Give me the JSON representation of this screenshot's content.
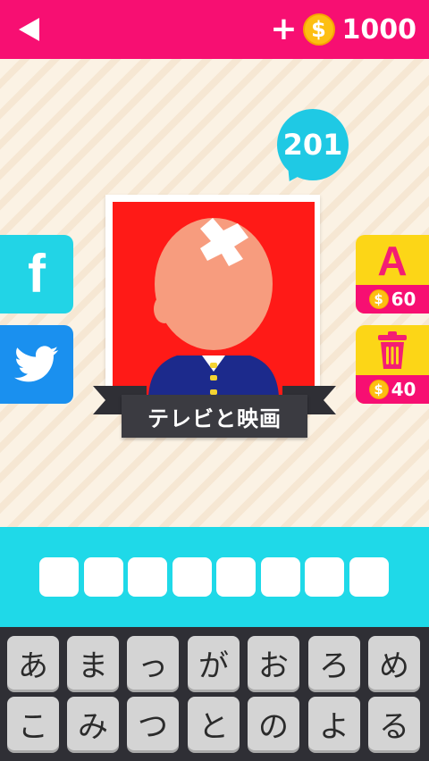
{
  "topbar": {
    "back_icon": "back-arrow-icon",
    "plus_label": "+",
    "coin_symbol": "$",
    "coin_amount": "1000",
    "bar_color": "#f70f72"
  },
  "level": {
    "number": "201"
  },
  "puzzle": {
    "category": "テレビと映画",
    "picture_description_icon": "bald-baby-in-suit-icon",
    "picture_bg": "#ff1a17"
  },
  "social": {
    "facebook_letter": "f",
    "facebook_icon": "facebook-icon",
    "twitter_icon": "twitter-bird-icon"
  },
  "helpers": [
    {
      "name": "reveal-letter",
      "label": "A",
      "price": "60"
    },
    {
      "name": "remove-letters",
      "icon": "trash-can-icon",
      "price": "40"
    }
  ],
  "answer": {
    "slot_count": 8
  },
  "keyboard": {
    "row1": [
      "あ",
      "ま",
      "っ",
      "が",
      "お",
      "ろ",
      "め"
    ],
    "row2": [
      "こ",
      "み",
      "つ",
      "と",
      "の",
      "よ",
      "る"
    ]
  }
}
